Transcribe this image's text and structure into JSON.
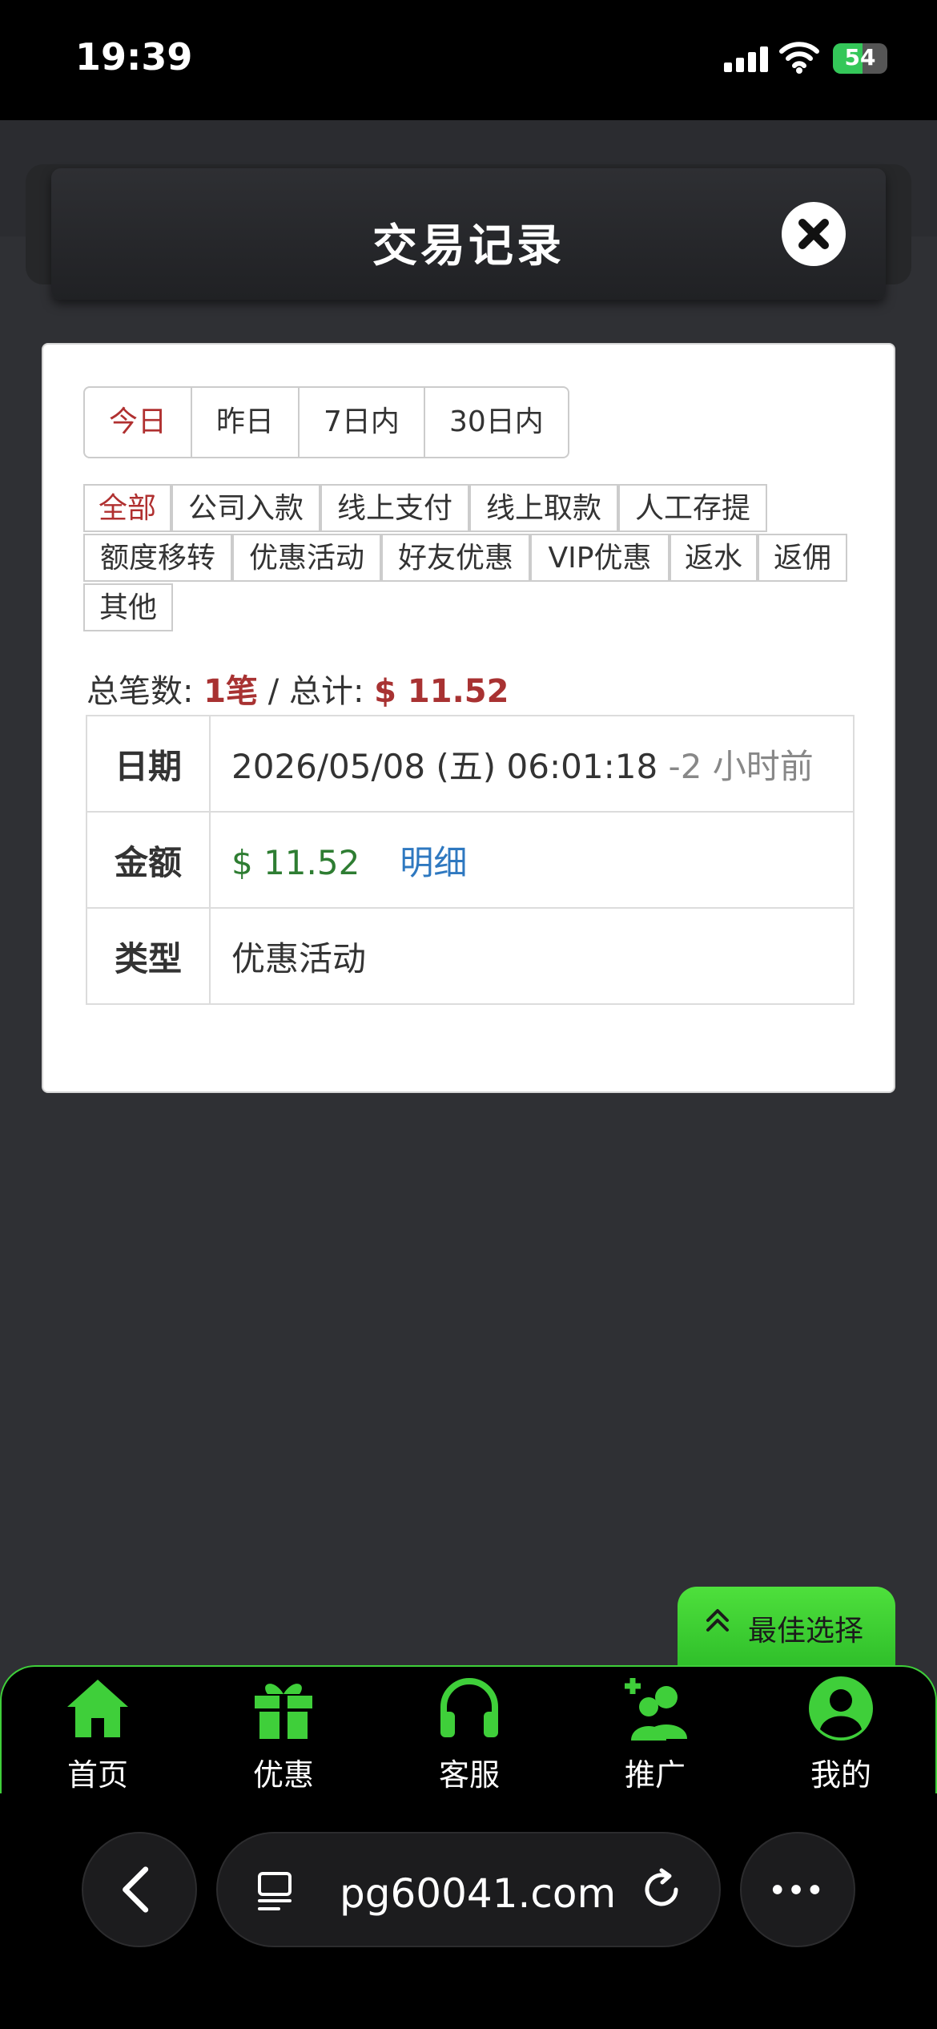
{
  "status_bar": {
    "time": "19:39",
    "battery": "54",
    "battery_fraction": 0.54
  },
  "header": {
    "title": "交易记录"
  },
  "date_tabs": [
    {
      "label": "今日",
      "active": true
    },
    {
      "label": "昨日",
      "active": false
    },
    {
      "label": "7日内",
      "active": false
    },
    {
      "label": "30日内",
      "active": false
    }
  ],
  "type_tabs": [
    {
      "label": "全部",
      "active": true
    },
    {
      "label": "公司入款",
      "active": false
    },
    {
      "label": "线上支付",
      "active": false
    },
    {
      "label": "线上取款",
      "active": false
    },
    {
      "label": "人工存提",
      "active": false
    },
    {
      "label": "额度移转",
      "active": false
    },
    {
      "label": "优惠活动",
      "active": false
    },
    {
      "label": "好友优惠",
      "active": false
    },
    {
      "label": "VIP优惠",
      "active": false
    },
    {
      "label": "返水",
      "active": false
    },
    {
      "label": "返佣",
      "active": false
    },
    {
      "label": "其他",
      "active": false
    }
  ],
  "summary": {
    "count_label": "总笔数:",
    "count_value": "1笔",
    "separator": " / ",
    "total_label": "总计:",
    "total_value": "$ 11.52"
  },
  "record": {
    "date_label": "日期",
    "date_value": "2026/05/08 (五) 06:01:18",
    "date_ago": " -2 小时前",
    "amount_label": "金额",
    "amount_value": "$ 11.52",
    "detail_link": "明细",
    "type_label": "类型",
    "type_value": "优惠活动"
  },
  "best_choice": {
    "label": "最佳选择"
  },
  "bottom_nav": [
    {
      "label": "首页",
      "icon": "home-icon"
    },
    {
      "label": "优惠",
      "icon": "gift-icon"
    },
    {
      "label": "客服",
      "icon": "headset-icon"
    },
    {
      "label": "推广",
      "icon": "add-users-icon"
    },
    {
      "label": "我的",
      "icon": "user-icon"
    }
  ],
  "browser": {
    "url": "pg60041.com"
  },
  "colors": {
    "accent_green": "#3fcf3a",
    "active_red": "#b03030",
    "amount_green": "#2e7d32",
    "link_blue": "#2e78c0"
  }
}
